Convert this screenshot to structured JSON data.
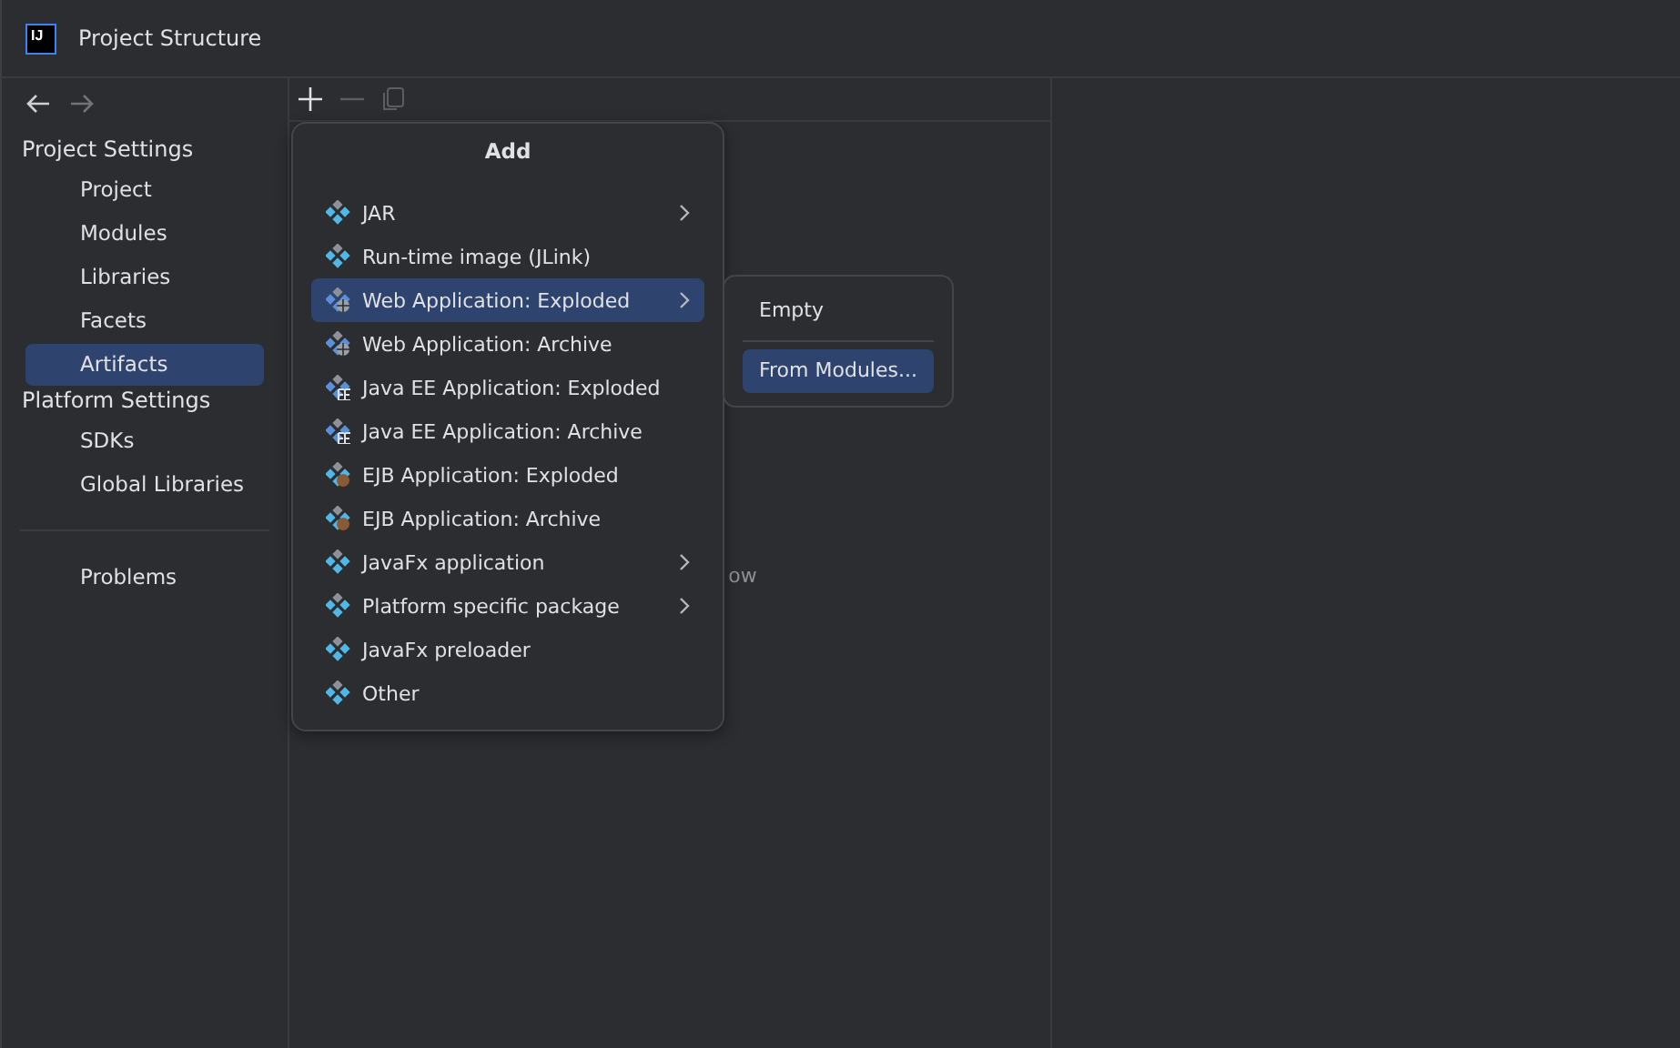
{
  "window": {
    "title": "Project Structure",
    "logo": "IJ"
  },
  "sidebar": {
    "sections": [
      {
        "title": "Project Settings",
        "items": [
          {
            "label": "Project",
            "selected": false
          },
          {
            "label": "Modules",
            "selected": false
          },
          {
            "label": "Libraries",
            "selected": false
          },
          {
            "label": "Facets",
            "selected": false
          },
          {
            "label": "Artifacts",
            "selected": true
          }
        ]
      },
      {
        "title": "Platform Settings",
        "items": [
          {
            "label": "SDKs",
            "selected": false
          },
          {
            "label": "Global Libraries",
            "selected": false
          }
        ]
      }
    ],
    "bottom_items": [
      {
        "label": "Problems",
        "selected": false
      }
    ]
  },
  "content": {
    "hint": "ow"
  },
  "add_menu": {
    "title": "Add",
    "items": [
      {
        "label": "JAR",
        "kind": "jar",
        "submenu": true,
        "selected": false
      },
      {
        "label": "Run-time image (JLink)",
        "kind": "jar",
        "submenu": false,
        "selected": false
      },
      {
        "label": "Web Application: Exploded",
        "kind": "web",
        "submenu": true,
        "selected": true
      },
      {
        "label": "Web Application: Archive",
        "kind": "web",
        "submenu": false,
        "selected": false
      },
      {
        "label": "Java EE Application: Exploded",
        "kind": "ee",
        "submenu": false,
        "selected": false
      },
      {
        "label": "Java EE Application: Archive",
        "kind": "ee",
        "submenu": false,
        "selected": false
      },
      {
        "label": "EJB Application: Exploded",
        "kind": "ejb",
        "submenu": false,
        "selected": false
      },
      {
        "label": "EJB Application: Archive",
        "kind": "ejb",
        "submenu": false,
        "selected": false
      },
      {
        "label": "JavaFx application",
        "kind": "jar",
        "submenu": true,
        "selected": false
      },
      {
        "label": "Platform specific package",
        "kind": "jar",
        "submenu": true,
        "selected": false
      },
      {
        "label": "JavaFx preloader",
        "kind": "jar",
        "submenu": false,
        "selected": false
      },
      {
        "label": "Other",
        "kind": "jar",
        "submenu": false,
        "selected": false
      }
    ]
  },
  "submenu": {
    "items": [
      {
        "label": "Empty",
        "selected": false
      },
      {
        "label": "From Modules...",
        "selected": true
      }
    ]
  }
}
